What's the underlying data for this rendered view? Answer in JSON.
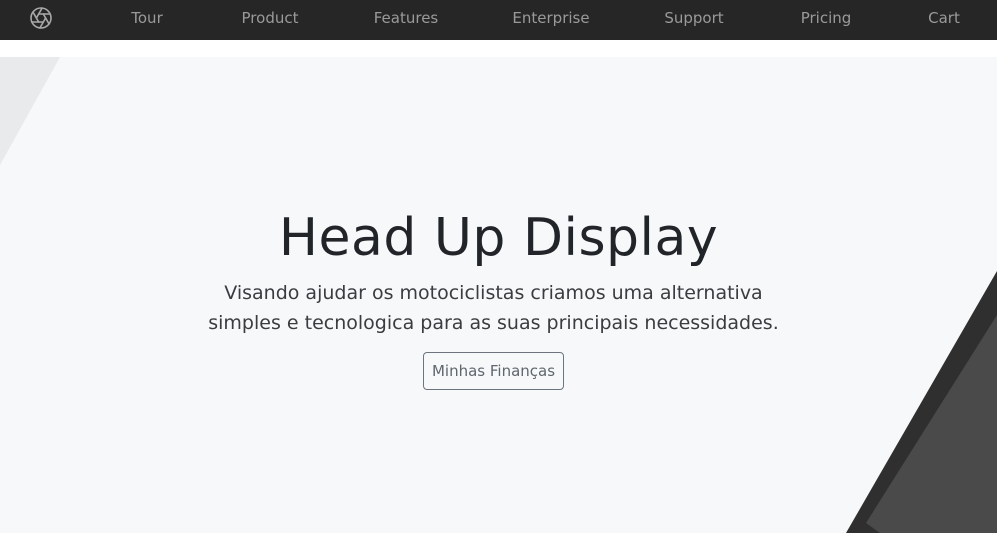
{
  "navbar": {
    "logo_icon": "aperture-icon",
    "items": [
      {
        "label": "Tour"
      },
      {
        "label": "Product"
      },
      {
        "label": "Features"
      },
      {
        "label": "Enterprise"
      },
      {
        "label": "Support"
      },
      {
        "label": "Pricing"
      },
      {
        "label": "Cart"
      }
    ]
  },
  "hero": {
    "title": "Head Up Display",
    "subtitle": "Visando ajudar os motociclistas criamos uma alternativa simples e tecnologica para as suas principais necessidades.",
    "button_label": "Minhas Finanças"
  },
  "colors": {
    "navbar_bg": "#262626",
    "nav_text": "#9a9a9a",
    "hero_bg": "#f7f8f9",
    "title_text": "#212529",
    "device_dark": "#2f2f2f",
    "device_screen": "#4a4a4a"
  }
}
